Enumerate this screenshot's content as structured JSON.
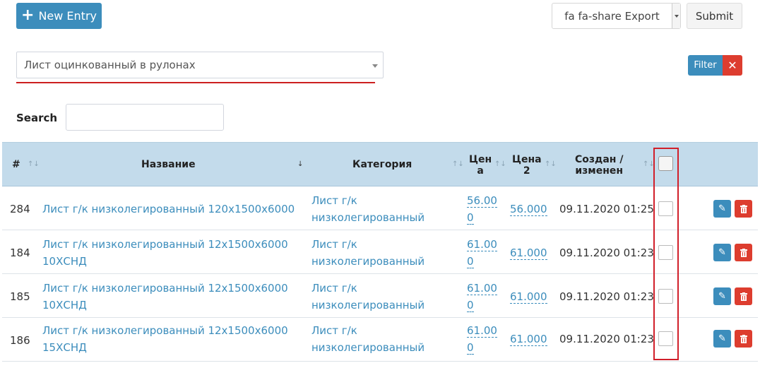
{
  "toolbar": {
    "new_entry_label": "New Entry",
    "export_label": "fa fa-share  Export",
    "submit_label": "Submit"
  },
  "filter": {
    "selected_category": "Лист оцинкованный в рулонах",
    "filter_label": "Filter",
    "clear_label": "✕"
  },
  "search": {
    "label": "Search",
    "value": ""
  },
  "table": {
    "columns": {
      "id": "#",
      "name": "Название",
      "category": "Категория",
      "price1_line1": "Цен",
      "price1_line2": "а",
      "price2_line1": "Цена",
      "price2_line2": "2",
      "date_line1": "Создан /",
      "date_line2": "изменен"
    },
    "rows": [
      {
        "id": "284",
        "name_line1": "Лист г/к низколегированный 120х1500х6000",
        "name_line2": "",
        "category_line1": "Лист г/к",
        "category_line2": "низколегированный",
        "price_line1": "56.00",
        "price_line2": "0",
        "price2": "56.000",
        "date": "09.11.2020 01:25"
      },
      {
        "id": "184",
        "name_line1": "Лист г/к низколегированный 12х1500х6000",
        "name_line2": "10ХСНД",
        "category_line1": "Лист г/к",
        "category_line2": "низколегированный",
        "price_line1": "61.00",
        "price_line2": "0",
        "price2": "61.000",
        "date": "09.11.2020 01:23"
      },
      {
        "id": "185",
        "name_line1": "Лист г/к низколегированный 12х1500х6000",
        "name_line2": "10ХСНД",
        "category_line1": "Лист г/к",
        "category_line2": "низколегированный",
        "price_line1": "61.00",
        "price_line2": "0",
        "price2": "61.000",
        "date": "09.11.2020 01:23"
      },
      {
        "id": "186",
        "name_line1": "Лист г/к низколегированный 12х1500х6000",
        "name_line2": "15ХСНД",
        "category_line1": "Лист г/к",
        "category_line2": "низколегированный",
        "price_line1": "61.00",
        "price_line2": "0",
        "price2": "61.000",
        "date": "09.11.2020 01:23"
      }
    ]
  },
  "colors": {
    "primary": "#3c8dbc",
    "danger": "#dd3d2f",
    "header_bg": "#c3dbeb",
    "highlight": "#d11f2a"
  }
}
